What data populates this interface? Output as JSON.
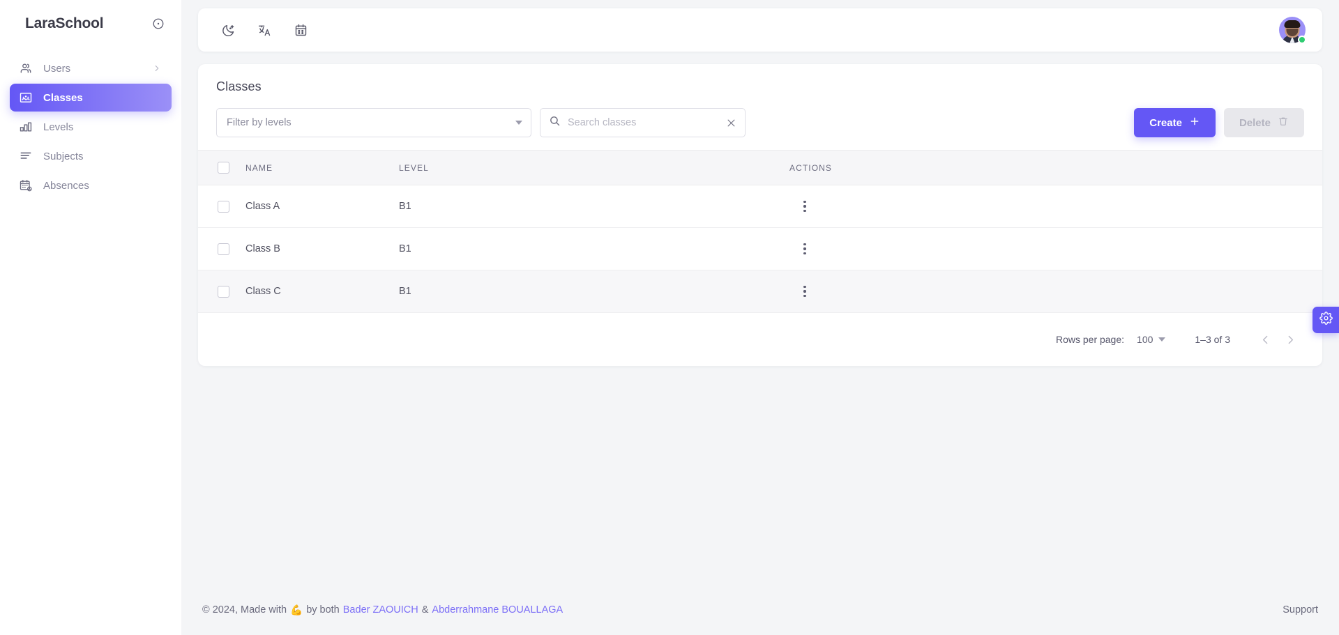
{
  "sidebar": {
    "brand": "LaraSchool",
    "collapse_icon": "circle-dot-icon",
    "items": [
      {
        "label": "Users",
        "icon": "users-icon",
        "active": false,
        "has_chevron": true
      },
      {
        "label": "Classes",
        "icon": "classroom-icon",
        "active": true,
        "has_chevron": false
      },
      {
        "label": "Levels",
        "icon": "bar-chart-icon",
        "active": false,
        "has_chevron": false
      },
      {
        "label": "Subjects",
        "icon": "list-icon",
        "active": false,
        "has_chevron": false
      },
      {
        "label": "Absences",
        "icon": "calendar-clock-icon",
        "active": false,
        "has_chevron": false
      }
    ]
  },
  "topbar": {
    "icons": [
      "moon-icon",
      "translate-icon",
      "calendar-icon"
    ],
    "avatar": {
      "name": "user-avatar",
      "status": "online",
      "status_color": "#2ecc71"
    }
  },
  "page": {
    "title": "Classes",
    "filter": {
      "placeholder": "Filter by levels",
      "value": ""
    },
    "search": {
      "placeholder": "Search classes",
      "value": ""
    },
    "create_label": "Create",
    "create_icon": "plus-icon",
    "delete_label": "Delete",
    "delete_icon": "trash-icon",
    "delete_disabled": true
  },
  "table": {
    "columns": [
      "NAME",
      "LEVEL",
      "ACTIONS"
    ],
    "rows": [
      {
        "name": "Class A",
        "level": "B1",
        "checked": false,
        "hovered": false
      },
      {
        "name": "Class B",
        "level": "B1",
        "checked": false,
        "hovered": false
      },
      {
        "name": "Class C",
        "level": "B1",
        "checked": false,
        "hovered": true
      }
    ]
  },
  "pagination": {
    "rows_per_page_label": "Rows per page:",
    "rows_per_page_value": "100",
    "range": "1–3 of 3",
    "prev_icon": "chevron-left-icon",
    "next_icon": "chevron-right-icon"
  },
  "footer": {
    "prefix": "© 2024, Made with",
    "emoji": "💪",
    "middle": "by both",
    "author1": "Bader ZAOUICH",
    "separator": "&",
    "author2": "Abderrahmane BOUALLAGA",
    "support": "Support"
  },
  "settings_tab": {
    "icon": "gear-icon"
  },
  "colors": {
    "accent": "#6457f5",
    "accent_light": "#9b90f7",
    "page_bg": "#f4f5f7",
    "card_bg": "#ffffff",
    "text": "#50505f",
    "muted": "#8b8b9c",
    "online": "#2ecc71"
  }
}
